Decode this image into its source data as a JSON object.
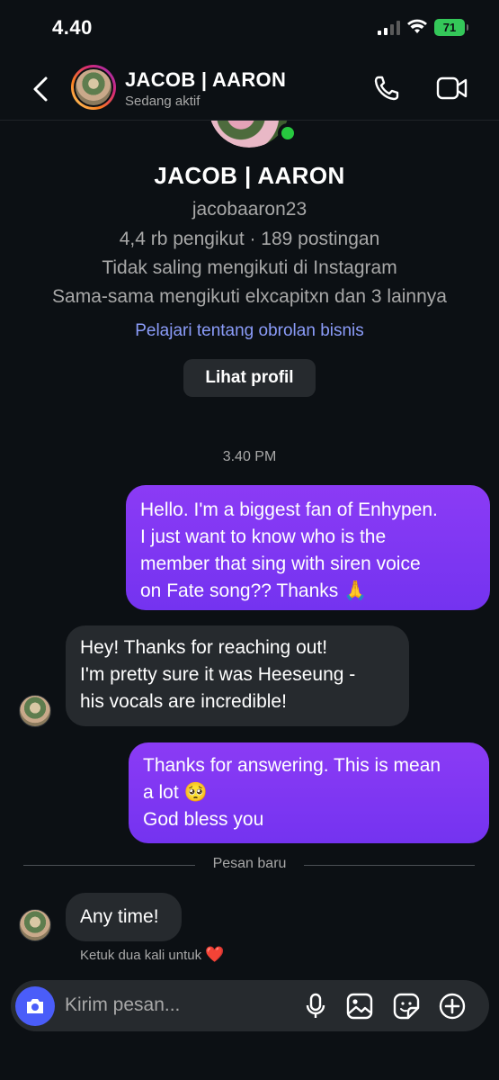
{
  "status_bar": {
    "time": "4.40",
    "battery": "71"
  },
  "header": {
    "name": "JACOB | AARON",
    "status": "Sedang aktif",
    "icons": {
      "back": "chevron-left-icon",
      "call": "phone-icon",
      "video": "video-camera-icon"
    }
  },
  "profile": {
    "name": "JACOB | AARON",
    "username": "jacobaaron23",
    "stats": "4,4 rb pengikut · 189 postingan",
    "follow_status": "Tidak saling mengikuti di Instagram",
    "mutual": "Sama-sama mengikuti elxcapitxn dan 3 lainnya",
    "business_link": "Pelajari tentang obrolan bisnis",
    "view_profile_label": "Lihat profil"
  },
  "conversation": {
    "timestamp": "3.40 PM",
    "messages": [
      {
        "direction": "outgoing",
        "lines": [
          "Hello. I'm a biggest fan of Enhypen.",
          "I just want to know who is the",
          "member that sing with siren voice",
          "on Fate song?? Thanks 🙏"
        ]
      },
      {
        "direction": "incoming",
        "lines": [
          "Hey! Thanks for reaching out!",
          "I'm pretty sure it was Heeseung -",
          "his vocals are incredible!"
        ]
      },
      {
        "direction": "outgoing",
        "lines": [
          "Thanks for answering. This is mean",
          "a lot 🥺",
          "God bless you"
        ]
      },
      {
        "direction": "incoming",
        "lines": [
          "Any time!"
        ]
      }
    ],
    "new_messages_divider": "Pesan baru",
    "double_tap_hint": "Ketuk dua kali untuk",
    "hint_emoji": "❤️"
  },
  "composer": {
    "placeholder": "Kirim pesan...",
    "icons": [
      "camera-icon",
      "microphone-icon",
      "gallery-icon",
      "sticker-icon",
      "plus-circle-icon"
    ],
    "camera_color": "#4a5df9"
  },
  "colors": {
    "background": "#0c1014",
    "outgoing_bubble": "#7a30f2",
    "incoming_bubble": "#262a2e",
    "online": "#27c93f",
    "link": "#8b9cf9"
  }
}
